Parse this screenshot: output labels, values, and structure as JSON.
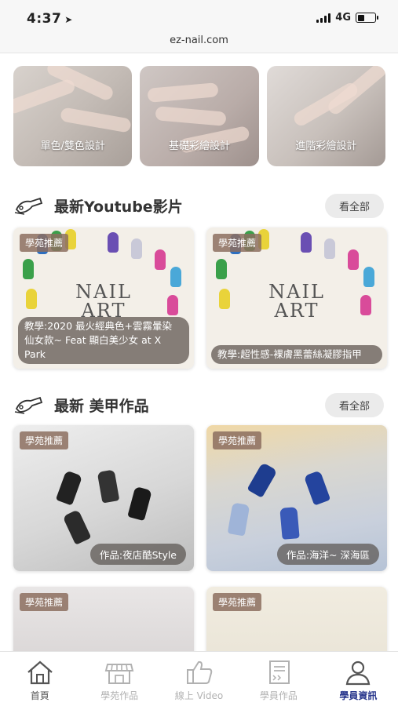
{
  "status_bar": {
    "time": "4:37",
    "network": "4G",
    "battery_level": 0.4
  },
  "browser": {
    "url": "ez-nail.com"
  },
  "categories": [
    {
      "label": "單色/雙色設計"
    },
    {
      "label": "基礎彩繪設計"
    },
    {
      "label": "進階彩繪設計"
    }
  ],
  "youtube_section": {
    "title": "最新Youtube影片",
    "see_all": "看全部",
    "items": [
      {
        "badge": "學苑推薦",
        "thumb_text_line1": "NAIL",
        "thumb_text_line2": "ART",
        "caption": "教學:2020 最火經典色+雲霧暈染 仙女款~ Feat 顯白美少女 at X Park"
      },
      {
        "badge": "學苑推薦",
        "thumb_text_line1": "NAIL",
        "thumb_text_line2": "ART",
        "caption": "教學:超性感-裸膚黑蕾絲凝膠指甲"
      }
    ]
  },
  "works_section": {
    "title": "最新 美甲作品",
    "see_all": "看全部",
    "items": [
      {
        "badge": "學苑推薦",
        "caption": "作品:夜店酷Style"
      },
      {
        "badge": "學苑推薦",
        "caption": "作品:海洋~ 深海區"
      },
      {
        "badge": "學苑推薦",
        "caption": ""
      },
      {
        "badge": "學苑推薦",
        "caption": ""
      }
    ]
  },
  "tab_bar": {
    "items": [
      {
        "label": "首頁",
        "icon": "home-icon"
      },
      {
        "label": "學苑作品",
        "icon": "storefront-icon"
      },
      {
        "label": "線上 Video",
        "icon": "thumbs-up-icon"
      },
      {
        "label": "學員作品",
        "icon": "certificate-icon"
      },
      {
        "label": "學員資訊",
        "icon": "user-icon"
      }
    ],
    "active_index": 4,
    "active_color": "#2c3a8f"
  }
}
